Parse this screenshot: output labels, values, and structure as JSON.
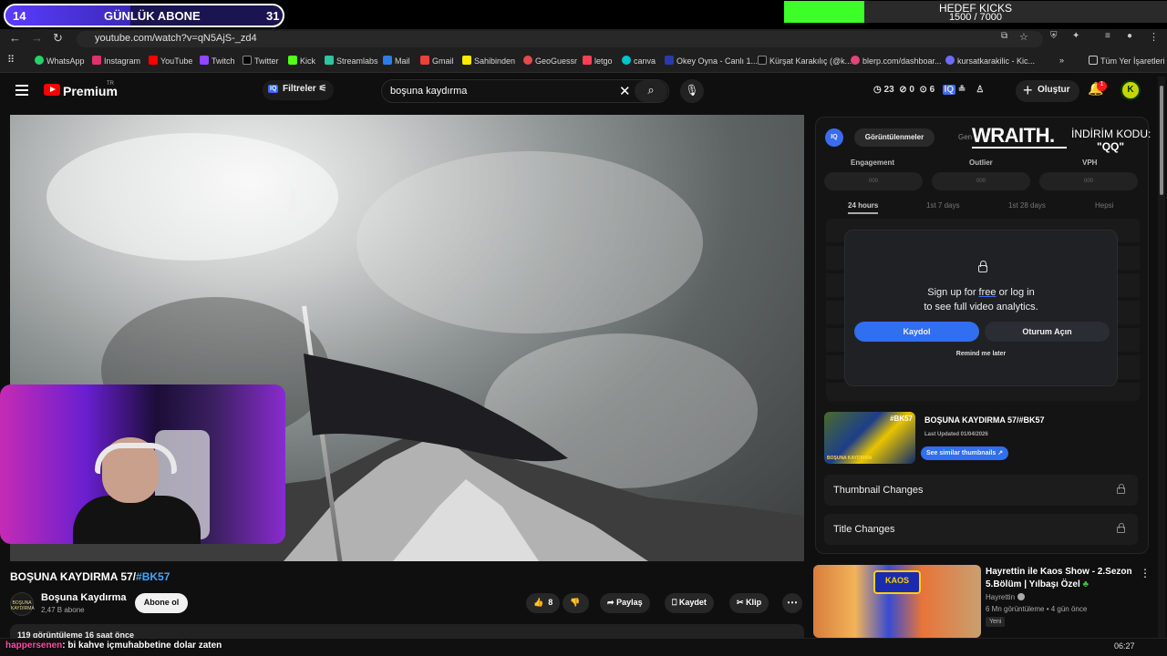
{
  "overlay": {
    "sub_goal": {
      "current": "14",
      "label": "GÜNLÜK ABONE",
      "target": "31",
      "progress": 0.45
    },
    "kick_goal": {
      "label": "HEDEF KICKS",
      "value": "1500 / 7000",
      "progress": 0.21
    }
  },
  "browser": {
    "url": "youtube.com/watch?v=qN5AjS-_zd4",
    "bookmarks": [
      "WhatsApp",
      "Instagram",
      "YouTube",
      "Twitch",
      "Twitter",
      "Kick",
      "Streamlabs",
      "Mail",
      "Gmail",
      "Sahibinden",
      "GeoGuessr",
      "letgo",
      "canva",
      "Okey Oyna - Canlı 1...",
      "Kürşat Karakılıç (@k...",
      "blerp.com/dashboar...",
      "kursatkarakilic - Kic..."
    ],
    "all_bookmarks": "Tüm Yer İşaretleri"
  },
  "youtube_header": {
    "brand": "Premium",
    "region": "TR",
    "filters_label": "Filtreler",
    "search_query": "boşuna kaydırma",
    "stats": {
      "a": "23",
      "b": "0",
      "c": "6"
    },
    "create_label": "Oluştur",
    "notification_count": "1",
    "avatar_letter": "K"
  },
  "video": {
    "title": "BOŞUNA KAYDIRMA 57/",
    "title_tag": "#BK57",
    "channel": "Boşuna Kaydırma",
    "channel_avatar_text": "BOŞUNA KAYDIRMA",
    "subscribers": "2,47 B abone",
    "subscribe_label": "Abone ol",
    "likes": "8",
    "share_label": "Paylaş",
    "save_label": "Kaydet",
    "clip_label": "Klip",
    "description_preview": "119 görüntüleme  16 saat önce"
  },
  "analytics_panel": {
    "badge": "IQ",
    "tab_active": "Görüntülenmeler",
    "tab_2": "Gen",
    "promo_brand": "WRAITH.",
    "promo_line1": "İNDİRİM KODU:",
    "promo_line2": "\"QQ\"",
    "metrics": [
      "Engagement",
      "Outlier",
      "VPH"
    ],
    "metric_placeholder": "000",
    "ranges": [
      "24 hours",
      "1st 7 days",
      "1st 28 days",
      "Hepsi"
    ],
    "gate_line1_pre": "Sign up for ",
    "gate_line1_link": "free",
    "gate_line1_post": " or log in",
    "gate_line2": "to see full video analytics.",
    "signup_label": "Kaydol",
    "login_label": "Oturum Açın",
    "remind_label": "Remind me later",
    "card_title": "BOŞUNA KAYDIRMA 57/#BK57",
    "card_updated": "Last Updated 01/04/2026",
    "card_tag": "#BK57",
    "card_thumb_text": "BOŞUNA KAYDIRMA",
    "similar_label": "See similar thumbnails ↗",
    "thumbnail_changes": "Thumbnail Changes",
    "title_changes": "Title Changes"
  },
  "recommendation": {
    "logo": "KAOS",
    "title_line1": "Hayrettin ile Kaos Show - 2.Sezon",
    "title_line2": "5.Bölüm | Yılbaşı Özel",
    "channel": "Hayrettin",
    "meta": "6 Mn görüntüleme • 4 gün önce",
    "badge": "Yeni"
  },
  "chat": {
    "user": "happersenen",
    "message": ": bi kahve içmuhabbetine dolar zaten"
  },
  "clock": "06:27"
}
